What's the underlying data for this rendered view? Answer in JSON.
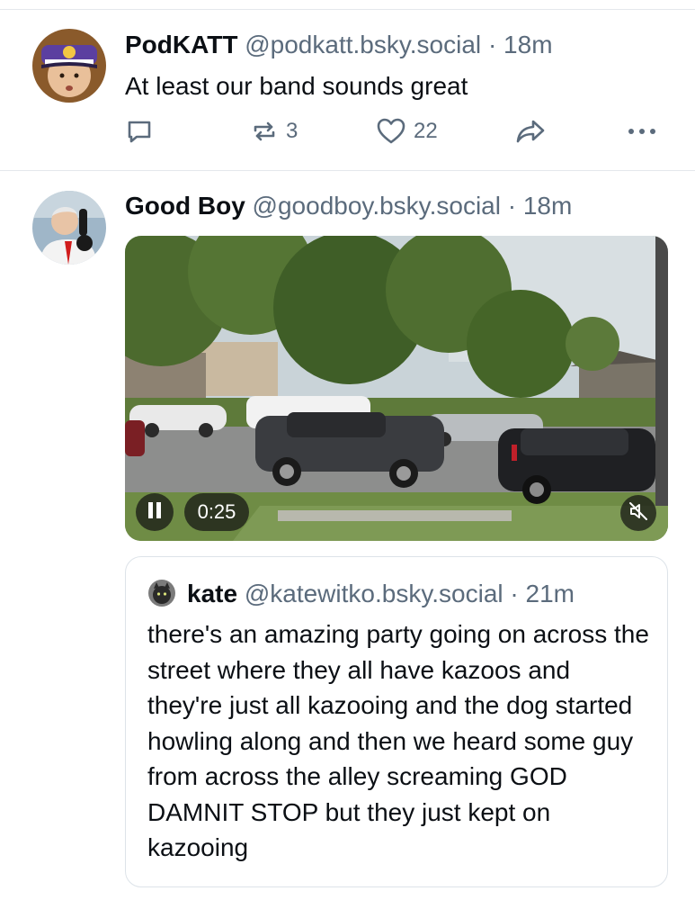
{
  "posts": [
    {
      "author_name": "PodKATT",
      "handle": "@podkatt.bsky.social",
      "separator": "·",
      "time": "18m",
      "text": "At least our band sounds great",
      "reply_count": "",
      "repost_count": "3",
      "like_count": "22"
    },
    {
      "author_name": "Good Boy",
      "handle": "@goodboy.bsky.social",
      "separator": "·",
      "time": "18m",
      "video": {
        "elapsed": "0:25",
        "state": "playing",
        "muted": true
      },
      "quote": {
        "author_name": "kate",
        "handle": "@katewitko.bsky.social",
        "separator": "·",
        "time": "21m",
        "text": "there's an amazing party going on across the street where they all have kazoos and they're just all kazooing and the dog started howling along and then we heard some guy from across the alley screaming GOD DAMNIT STOP but they just kept on kazooing"
      }
    }
  ],
  "icons": {
    "reply": "reply-icon",
    "repost": "repost-icon",
    "like": "heart-icon",
    "share": "share-icon",
    "more": "more-icon",
    "pause": "pause-icon",
    "mute": "mute-icon"
  },
  "colors": {
    "text": "#0b0f14",
    "muted": "#5b6b7c",
    "divider": "#e4e8ec"
  }
}
